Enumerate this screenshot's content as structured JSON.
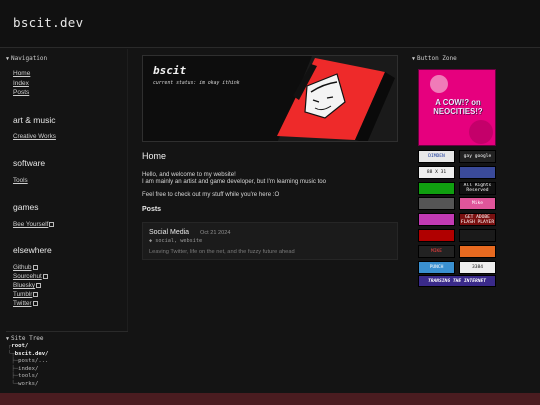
{
  "site": {
    "title": "bscit.dev"
  },
  "navigation": {
    "title": "Navigation",
    "links": [
      "Home",
      "Index",
      "Posts"
    ]
  },
  "sections": [
    {
      "heading": "art & music",
      "links": [
        {
          "label": "Creative Works",
          "external": false
        }
      ]
    },
    {
      "heading": "software",
      "links": [
        {
          "label": "Tools",
          "external": false
        }
      ]
    },
    {
      "heading": "games",
      "links": [
        {
          "label": "Bee Yourself",
          "external": true
        }
      ]
    },
    {
      "heading": "elsewhere",
      "links": [
        {
          "label": "Github",
          "external": true
        },
        {
          "label": "Sourcehut",
          "external": true
        },
        {
          "label": "Bluesky",
          "external": true
        },
        {
          "label": "Tumblr",
          "external": true
        },
        {
          "label": "Twitter",
          "external": true
        }
      ]
    }
  ],
  "site_tree": {
    "title": "Site Tree",
    "root": "root/",
    "site": "bscit.dev/",
    "children": [
      "posts/...",
      "index/",
      "tools/",
      "works/"
    ]
  },
  "banner": {
    "title": "bscit",
    "status": "current status: im okay ithink"
  },
  "main": {
    "heading": "Home",
    "intro_line1": "Hello, and welcome to my website!",
    "intro_line2": "I am mainly an artist and game developer, but I'm learning music too",
    "intro_line3": "Feel free to check out my stuff while you're here :O",
    "posts_heading": "Posts",
    "post": {
      "title": "Social Media",
      "date": "Oct 21 2024",
      "tags": "social, website",
      "summary": "Leaving Twitter, life on the net, and the fuzzy future ahead"
    }
  },
  "button_zone": {
    "title": "Button Zone",
    "featured": "A COW!? on NEOCITIES!?",
    "buttons": [
      {
        "text": "DIMDEN",
        "bg": "#e8e8e8",
        "fg": "#1a3a9a"
      },
      {
        "text": "gay google",
        "bg": "#222",
        "fg": "#ffffff"
      },
      {
        "text": "88 X 31",
        "bg": "#eeeeee",
        "fg": "#111"
      },
      {
        "text": "",
        "bg": "#3a4a9a",
        "fg": "#fff"
      },
      {
        "text": "",
        "bg": "#10a010",
        "fg": "#fff"
      },
      {
        "text": "All Rights Reserved",
        "bg": "#111",
        "fg": "#fff"
      },
      {
        "text": "",
        "bg": "#555",
        "fg": "#fff"
      },
      {
        "text": "Mike",
        "bg": "#e0559a",
        "fg": "#ffffff"
      },
      {
        "text": "",
        "bg": "#c13ab3",
        "fg": "#fff"
      },
      {
        "text": "GET ADOBE FLASH PLAYER",
        "bg": "#7a1010",
        "fg": "#fff"
      },
      {
        "text": "",
        "bg": "#b00000",
        "fg": "#fff"
      },
      {
        "text": "",
        "bg": "#1a1a1a",
        "fg": "#fff"
      },
      {
        "text": "MIKE",
        "bg": "#222",
        "fg": "#ff4040"
      },
      {
        "text": "",
        "bg": "#e86a20",
        "fg": "#fff"
      },
      {
        "text": "PUNCH",
        "bg": "#3a90d0",
        "fg": "#ffffff"
      },
      {
        "text": "3384",
        "bg": "#eeeeee",
        "fg": "#111"
      }
    ],
    "trans": "TRANSING THE INTERNET"
  },
  "colors": {
    "background": "#141414",
    "accent_pink": "#e6007e",
    "footer": "#4a1c20"
  }
}
